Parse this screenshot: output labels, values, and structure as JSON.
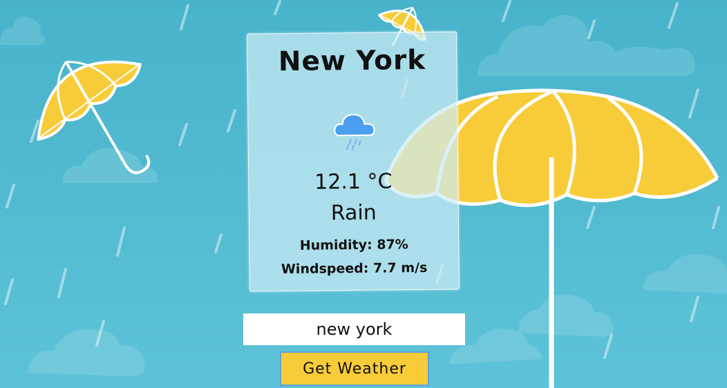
{
  "weather": {
    "city": "New York",
    "temperature": "12.1 °C",
    "condition": "Rain",
    "humidity": "Humidity: 87%",
    "windspeed": "Windspeed: 7.7 m/s",
    "icon": "rain-cloud-icon"
  },
  "search": {
    "value": "new york"
  },
  "button": {
    "label": "Get Weather"
  },
  "colors": {
    "background": "#52bad0",
    "umbrella": "#f8cb38",
    "button_border": "#5d9fd8",
    "icon_cloud": "#4c9ff0"
  }
}
